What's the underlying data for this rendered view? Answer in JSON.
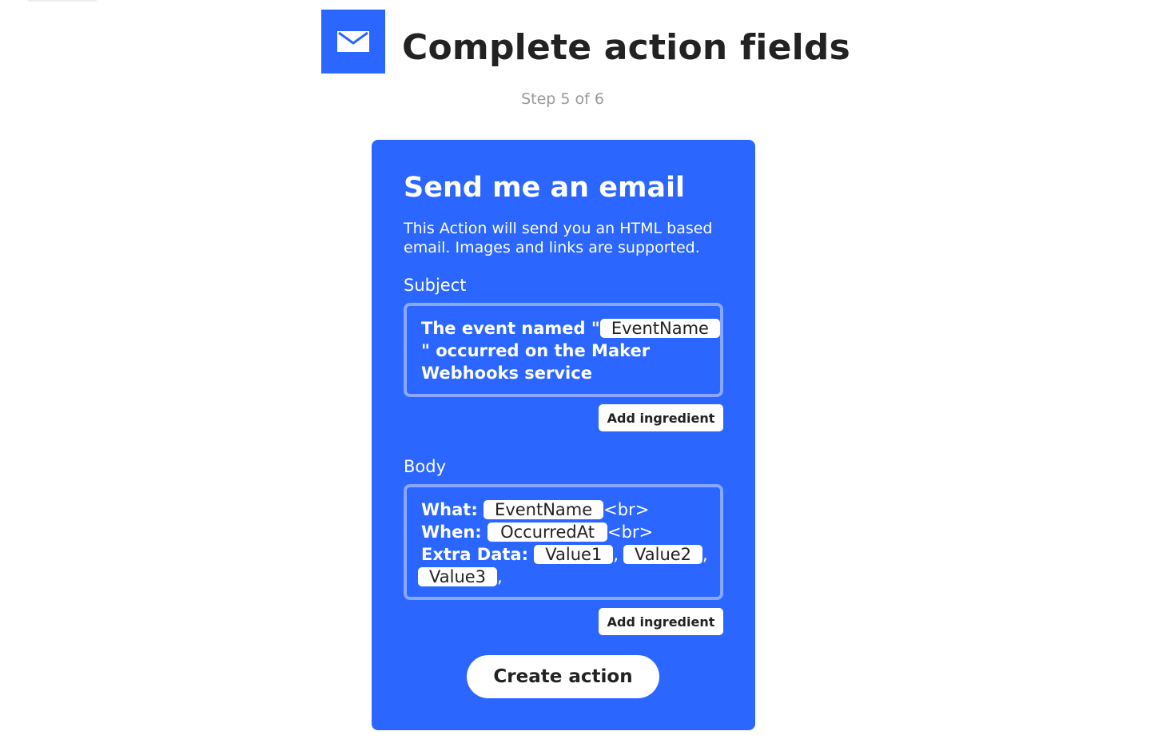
{
  "header": {
    "title": "Complete action fields",
    "step": "Step 5 of 6",
    "service_icon": "envelope-icon",
    "icon_color": "#2a66ff"
  },
  "action": {
    "title": "Send me an email",
    "description": "This Action will send you an HTML based email. Images and links are supported.",
    "accent_color": "#2a66ff",
    "subject": {
      "label": "Subject",
      "parts": {
        "prefix": "The event named \"",
        "ingredient": "EventName",
        "suffix": "\" occurred on the Maker Webhooks service"
      },
      "add_ingredient_label": "Add ingredient"
    },
    "body": {
      "label": "Body",
      "lines": {
        "what_label": "What: ",
        "what_ingredient": "EventName",
        "what_suffix": "<br>",
        "when_label": "When: ",
        "when_ingredient": "OccurredAt",
        "when_suffix": "<br>",
        "extra_label": "Extra Data: ",
        "value1": "Value1",
        "value2": "Value2",
        "value3": "Value3",
        "separator": ","
      },
      "add_ingredient_label": "Add ingredient"
    },
    "create_button_label": "Create action"
  }
}
